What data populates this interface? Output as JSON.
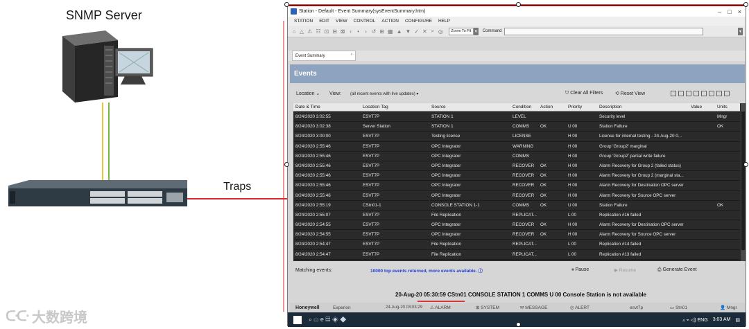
{
  "diagram": {
    "server_label": "SNMP Server",
    "link_label": "Traps",
    "watermark_text": "大数跨境",
    "watermark_mark": "ᑢᑢ",
    "colors": {
      "trap_line": "#d8262b",
      "cable_yellow": "#e5c53a",
      "cable_green": "#79b542"
    }
  },
  "window": {
    "title": "Station - Default - Event Summary(sysEventSummary.htm)",
    "controls": [
      "–",
      "□",
      "×"
    ],
    "menu": [
      "STATION",
      "EDIT",
      "VIEW",
      "CONTROL",
      "ACTION",
      "CONFIGURE",
      "HELP"
    ],
    "toolbar": {
      "icons": [
        "⌂",
        "△",
        "⚠",
        "☷",
        "⊡",
        "⊟",
        "⊠",
        "‹",
        "•",
        "›",
        "↺",
        "⊞",
        "▦",
        "▲",
        "▼",
        "✓",
        "✕",
        "⌕",
        "◎"
      ],
      "zoom_label": "Zoom To Fit",
      "zoom_drop": "▾",
      "command_label": "Command",
      "command_drop": "▾"
    },
    "tab": {
      "label": "Event Summary",
      "arrow": "›"
    },
    "events_title": "Events",
    "filter": {
      "location": "Location ⌄",
      "view_label": "View:",
      "view_value": "(all recent events with live updates) ▾",
      "clear": "⛉ Clear All Filters",
      "reset": "⟲ Reset View"
    },
    "table": {
      "columns": [
        "Date & Time",
        "Location Tag",
        "Source",
        "Condition",
        "Action",
        "Priority",
        "Description",
        "Value",
        "Units"
      ],
      "rows": [
        [
          "8/24/2020 3:02:55",
          "ESVT7P",
          "STATION 1",
          "LEVEL",
          "",
          "",
          "Security level",
          "",
          "Mngr"
        ],
        [
          "8/24/2020 3:02:38",
          "Server Station",
          "STATION 1",
          "COMMS",
          "OK",
          "U 00",
          "Station Failure",
          "",
          "OK"
        ],
        [
          "8/24/2020 3:00:00",
          "ESVT7P",
          "Testing license",
          "LICENSE",
          "",
          "H 00",
          "License for internal testing - 24-Aug-20  0...",
          "",
          ""
        ],
        [
          "8/24/2020 2:55:46",
          "ESVT7P",
          "OPC Integrator",
          "WARNING",
          "",
          "H 00",
          "Group 'Group2' marginal",
          "",
          ""
        ],
        [
          "8/24/2020 2:55:46",
          "ESVT7P",
          "OPC Integrator",
          "COMMS",
          "",
          "H 00",
          "Group 'Group2' partial write failure",
          "",
          ""
        ],
        [
          "8/24/2020 2:55:46",
          "ESVT7P",
          "OPC Integrator",
          "RECOVER",
          "OK",
          "H 00",
          "Alarm Recovery for Group 2 (failed status)",
          "",
          ""
        ],
        [
          "8/24/2020 2:55:46",
          "ESVT7P",
          "OPC Integrator",
          "RECOVER",
          "OK",
          "H 00",
          "Alarm Recovery for Group 2 (marginal sta...",
          "",
          ""
        ],
        [
          "8/24/2020 2:55:46",
          "ESVT7P",
          "OPC Integrator",
          "RECOVER",
          "OK",
          "H 00",
          "Alarm Recovery for Destination OPC server",
          "",
          ""
        ],
        [
          "8/24/2020 2:55:46",
          "ESVT7P",
          "OPC Integrator",
          "RECOVER",
          "OK",
          "H 00",
          "Alarm Recovery for Source OPC server",
          "",
          ""
        ],
        [
          "8/24/2020 2:55:19",
          "CStn01-1",
          "CONSOLE STATION 1-1",
          "COMMS",
          "OK",
          "U 00",
          "Station Failure",
          "",
          "OK"
        ],
        [
          "8/24/2020 2:55:07",
          "ESVT7P",
          "File Replication",
          "REPLICAT...",
          "",
          "L 00",
          "Replication #16 failed",
          "",
          ""
        ],
        [
          "8/24/2020 2:54:55",
          "ESVT7P",
          "OPC Integrator",
          "RECOVER",
          "OK",
          "H 00",
          "Alarm Recovery for Destination OPC server",
          "",
          ""
        ],
        [
          "8/24/2020 2:54:55",
          "ESVT7P",
          "OPC Integrator",
          "RECOVER",
          "OK",
          "H 00",
          "Alarm Recovery for Source OPC server",
          "",
          ""
        ],
        [
          "8/24/2020 2:54:47",
          "ESVT7P",
          "File Replication",
          "REPLICAT...",
          "",
          "L 00",
          "Replication #14 failed",
          "",
          ""
        ],
        [
          "8/24/2020 2:54:47",
          "ESVT7P",
          "File Replication",
          "REPLICAT...",
          "",
          "L 00",
          "Replication #13 failed",
          "",
          ""
        ]
      ]
    },
    "matching": {
      "label": "Matching events:",
      "result": "10000 top events returned, more events available. ⓘ",
      "pause": "⏸ Pause",
      "resume": "▶ Resume",
      "generate": "⎙ Generate Event"
    },
    "alarm_line": "20-Aug-20  05:30:59  CStn01   CONSOLE STATION 1   COMMS   U 00 Console Station is not available",
    "status": {
      "brand": "Honeywell",
      "product": "Experion",
      "date": "24-Aug-20  03:03:29",
      "alarm": "⚠ ALARM",
      "system": "⊞ SYSTEM",
      "message": "✉ MESSAGE",
      "alert": "◎ ALERT",
      "host": "esvt7p",
      "station": "▭ Stn01",
      "user": "👤 Mngr"
    },
    "taskbar": {
      "apps": "⌕  ▭  e  ▤  ◈  ◆",
      "tray": "▵  ⌁  ◁)  ENG",
      "time": "3:03 AM",
      "notify": "▤"
    }
  }
}
